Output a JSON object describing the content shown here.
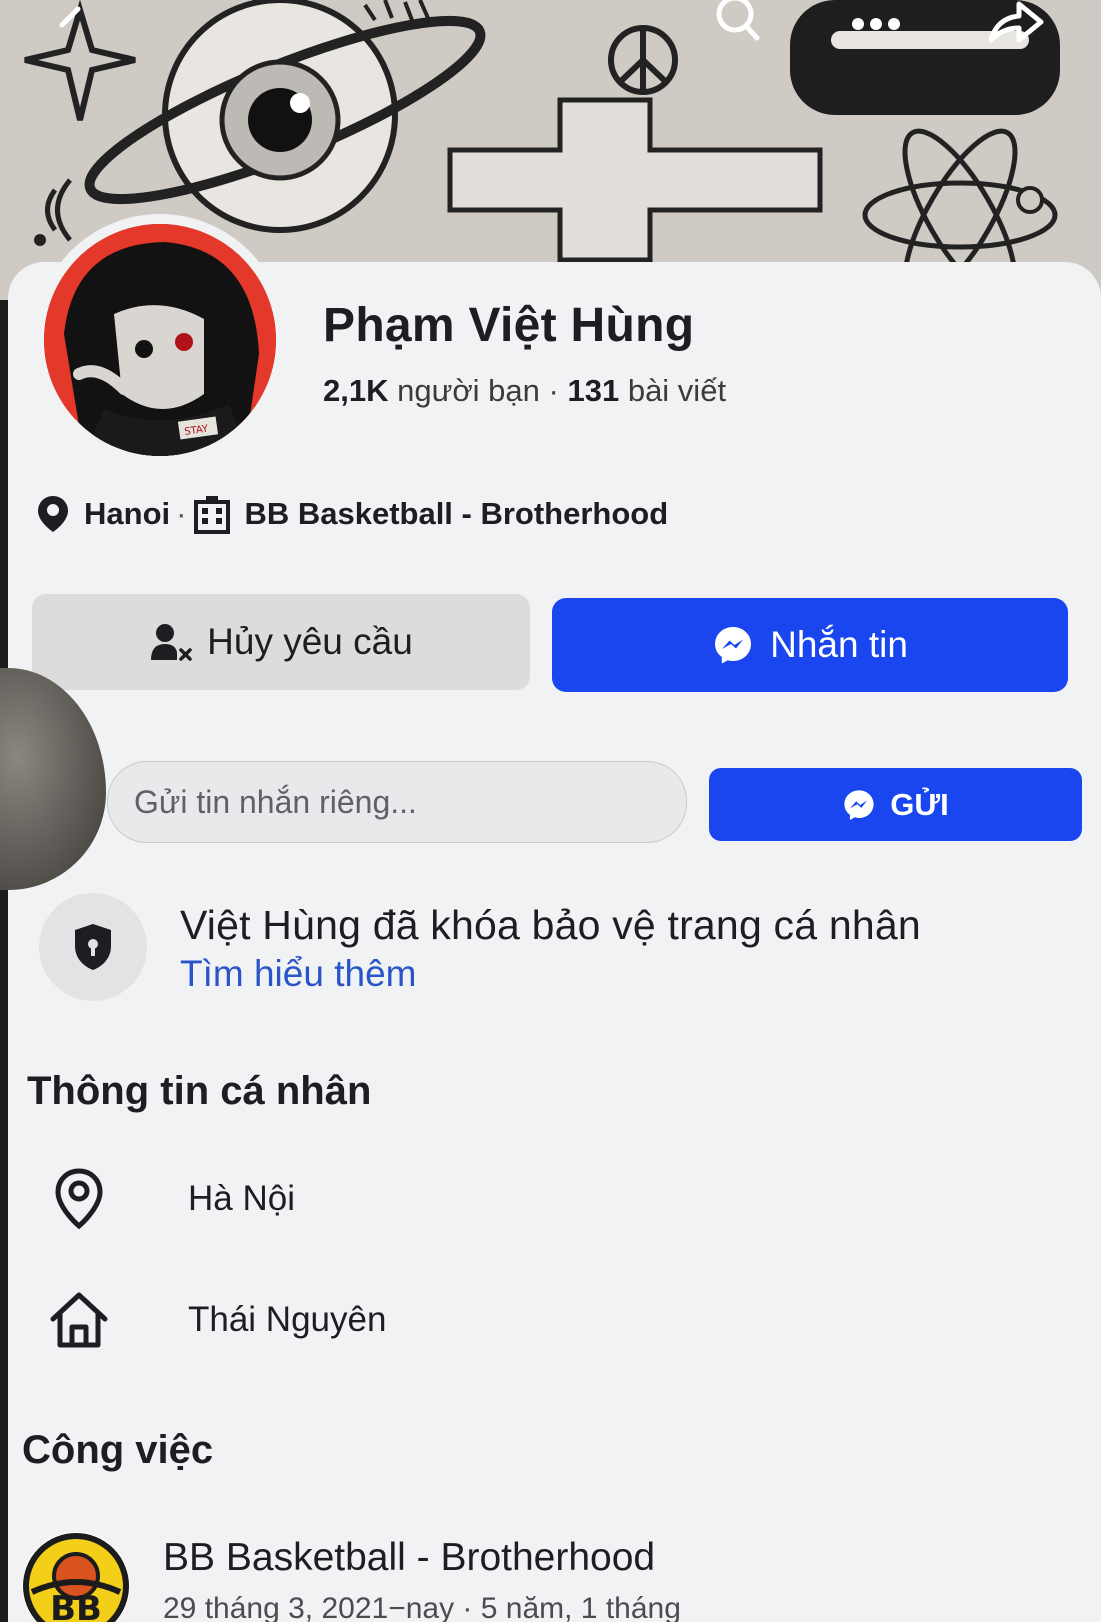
{
  "profile": {
    "name": "Phạm Việt Hùng",
    "friends_count": "2,1K",
    "friends_label": "người bạn",
    "posts_count": "131",
    "posts_label": "bài viết",
    "location_short": "Hanoi",
    "workplace_short": "BB Basketball - Brotherhood"
  },
  "actions": {
    "cancel_request_label": "Hủy yêu cầu",
    "message_label": "Nhắn tin",
    "private_message_placeholder": "Gửi tin nhắn riêng...",
    "send_label": "GỬI"
  },
  "lock_notice": {
    "title": "Việt Hùng đã khóa bảo vệ trang cá nhân",
    "learn_more": "Tìm hiểu thêm"
  },
  "personal_info": {
    "section_title": "Thông tin cá nhân",
    "current_city": "Hà Nội",
    "hometown": "Thái Nguyên"
  },
  "work": {
    "section_title": "Công việc",
    "company": "BB Basketball - Brotherhood",
    "dates": "29 tháng 3, 2021−nay · 5 năm, 1 tháng",
    "logo_text": "BB"
  },
  "avatar": {
    "badge_text": "STAY"
  },
  "colors": {
    "primary_blue": "#1a46f0",
    "link_blue": "#2a55c9",
    "card_bg": "#f1f2f4",
    "avatar_red": "#e4382a"
  },
  "icons": [
    "back-icon",
    "search-icon",
    "more-icon",
    "share-icon",
    "location-pin-icon",
    "building-icon",
    "person-remove-icon",
    "messenger-icon",
    "shield-lock-icon",
    "map-pin-outline-icon",
    "home-icon"
  ]
}
